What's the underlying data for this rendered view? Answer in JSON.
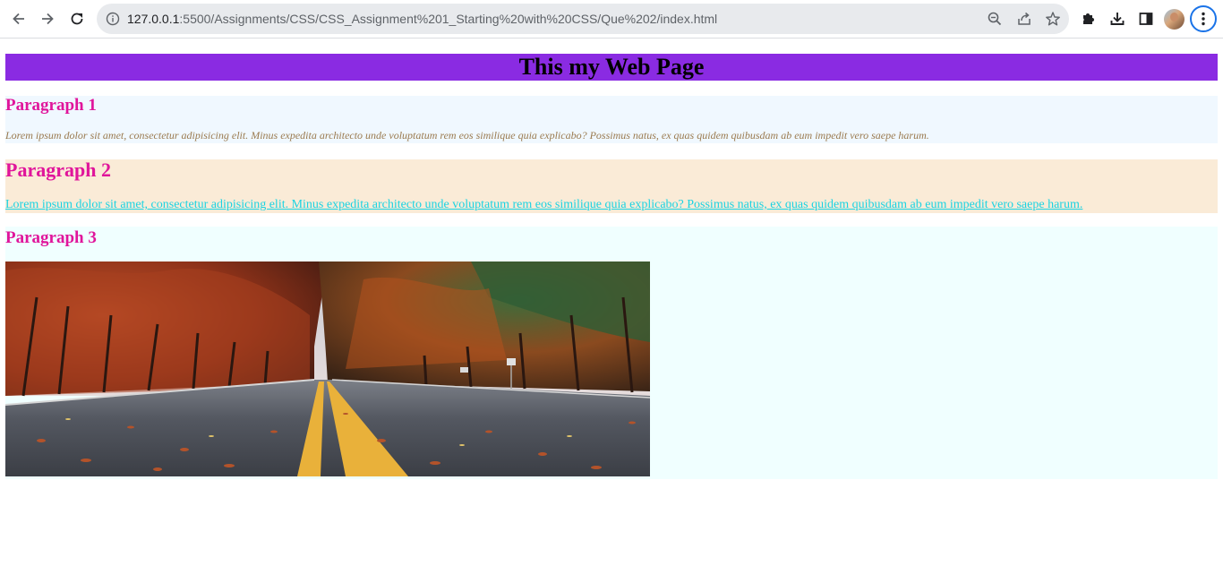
{
  "browser": {
    "url_host": "127.0.0.1",
    "url_rest": ":5500/Assignments/CSS/CSS_Assignment%201_Starting%20with%20CSS/Que%202/index.html",
    "icons": {
      "back": "arrow-left-icon",
      "forward": "arrow-right-icon",
      "reload": "reload-icon",
      "site_info": "info-icon",
      "zoom": "zoom-icon",
      "share": "share-icon",
      "bookmark": "star-icon",
      "extensions": "puzzle-icon",
      "downloads": "download-icon",
      "side_panel": "side-panel-icon",
      "profile": "avatar",
      "menu": "kebab-menu-icon"
    }
  },
  "page": {
    "header": "This my Web Page",
    "header_bg": "#8a2be2",
    "sections": [
      {
        "title": "Paragraph 1",
        "text": "Lorem ipsum dolor sit amet, consectetur adipisicing elit. Minus expedita architecto unde voluptatum rem eos similique quia explicabo? Possimus natus, ex quas quidem quibusdam ab eum impedit vero saepe harum.",
        "bg": "#f0f8ff"
      },
      {
        "title": "Paragraph 2",
        "link_text": "Lorem ipsum dolor sit amet, consectetur adipisicing elit. Minus expedita architecto unde voluptatum rem eos similique quia explicabo? Possimus natus, ex quas quidem quibusdam ab eum impedit vero saepe harum.",
        "bg": "#faebd7"
      },
      {
        "title": "Paragraph 3",
        "image": "autumn-road-image",
        "bg": "#f0ffff"
      }
    ],
    "title_color": "#e0159b",
    "link_color": "#1ad3e2"
  }
}
